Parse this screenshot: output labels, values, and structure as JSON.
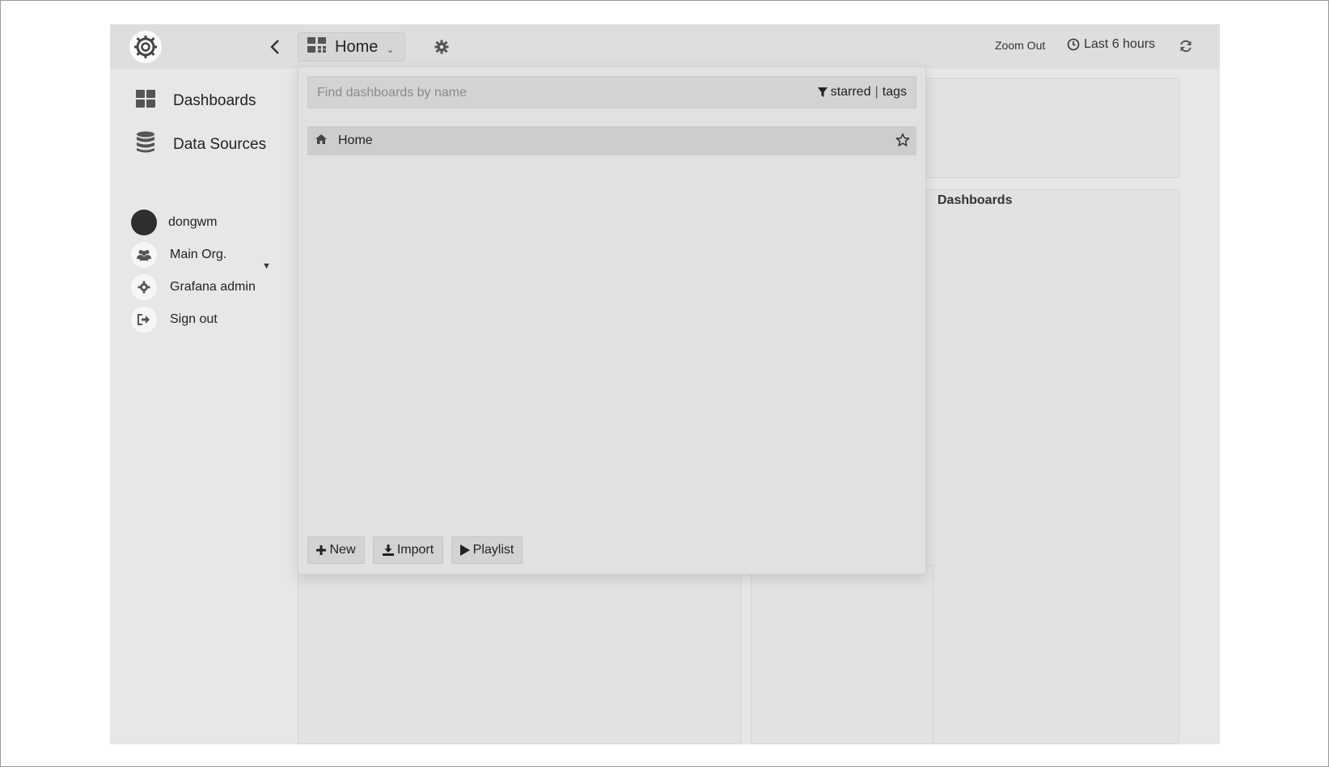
{
  "navbar": {
    "dashboard_title": "Home",
    "zoom_out_label": "Zoom Out",
    "time_range_label": "Last 6 hours"
  },
  "sidebar": {
    "items": [
      {
        "label": "Dashboards",
        "icon": "dashboards-grid-icon"
      },
      {
        "label": "Data Sources",
        "icon": "database-icon"
      }
    ],
    "user": {
      "username": "dongwm",
      "org_label": "Main Org.",
      "admin_label": "Grafana admin",
      "signout_label": "Sign out"
    }
  },
  "search": {
    "placeholder": "Find dashboards by name",
    "filter_starred": "starred",
    "filter_separator": "|",
    "filter_tags": "tags",
    "results": [
      {
        "title": "Home",
        "icon": "home-icon",
        "starred": false
      }
    ],
    "buttons": {
      "new": "New",
      "import": "Import",
      "playlist": "Playlist"
    }
  },
  "panels": {
    "dashboards_title": "Dashboards"
  },
  "colors": {
    "app_bg": "#e7e7e7",
    "navbar_bg": "#dedede",
    "search_bg": "#e1e1e1",
    "result_bg": "#cdcdcd"
  }
}
